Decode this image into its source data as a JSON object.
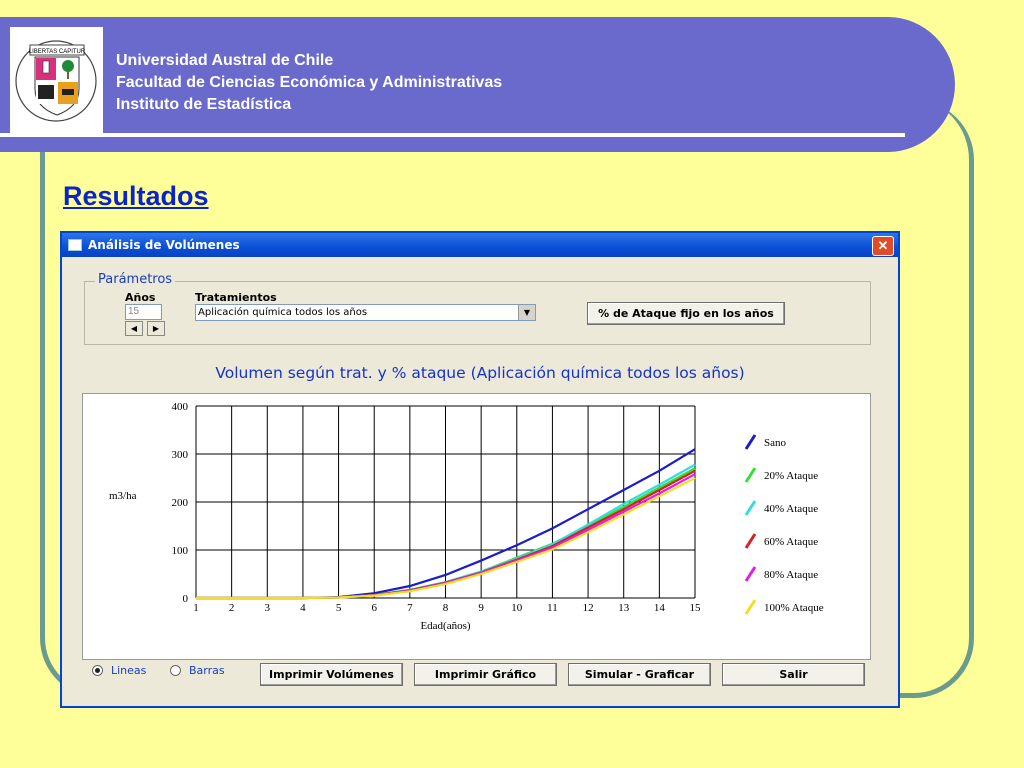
{
  "header": {
    "lines": [
      "Universidad Austral de Chile",
      "Facultad de Ciencias Económica y Administrativas",
      "Instituto de Estadística"
    ],
    "logo_motto": "LIBERTAS CAPITUR",
    "logo_ring": "UNIVERSIDAD AUSTRAL DE CHILE"
  },
  "slide_title": "Resultados",
  "window": {
    "title": "Análisis de Volúmenes",
    "close_label": "✕",
    "parameters": {
      "group_label": "Parámetros",
      "years_label": "Años",
      "years_value": "15",
      "treatments_label": "Tratamientos",
      "treatment_selected": "Aplicación química todos los años",
      "fixed_attack_button": "% de Ataque fijo en los años"
    },
    "chart_title": "Volumen según trat. y % ataque (Aplicación química todos los años)",
    "view": {
      "lines_label": "Lineas",
      "bars_label": "Barras",
      "selected": "Lineas"
    },
    "buttons": {
      "print_volumes": "Imprimir Volúmenes",
      "print_chart": "Imprimir Gráfico",
      "simulate": "Simular - Graficar",
      "exit": "Salir"
    }
  },
  "chart_data": {
    "type": "line",
    "xlabel": "Edad(años)",
    "ylabel": "m3/ha",
    "xlim": [
      1,
      15
    ],
    "ylim": [
      0,
      400
    ],
    "x": [
      1,
      2,
      3,
      4,
      5,
      6,
      7,
      8,
      9,
      10,
      11,
      12,
      13,
      14,
      15
    ],
    "yticks": [
      0,
      100,
      200,
      300,
      400
    ],
    "grid": true,
    "legend_position": "right",
    "series": [
      {
        "name": "Sano",
        "color": "#1c1cc8",
        "values": [
          0,
          0,
          0,
          0,
          2,
          10,
          25,
          48,
          78,
          110,
          145,
          185,
          225,
          265,
          310
        ]
      },
      {
        "name": "20% Ataque",
        "color": "#33e033",
        "values": [
          0,
          0,
          0,
          0,
          1,
          6,
          17,
          33,
          55,
          84,
          113,
          150,
          190,
          230,
          270
        ]
      },
      {
        "name": "40% Ataque",
        "color": "#33dddd",
        "values": [
          0,
          0,
          0,
          0,
          1,
          6,
          17,
          33,
          55,
          82,
          112,
          153,
          196,
          236,
          278
        ]
      },
      {
        "name": "60% Ataque",
        "color": "#d82020",
        "values": [
          0,
          0,
          0,
          0,
          1,
          6,
          16,
          32,
          53,
          80,
          108,
          147,
          185,
          225,
          265
        ]
      },
      {
        "name": "80% Ataque",
        "color": "#e020e0",
        "values": [
          0,
          0,
          0,
          0,
          1,
          5,
          15,
          31,
          52,
          78,
          105,
          142,
          180,
          218,
          258
        ]
      },
      {
        "name": "100% Ataque",
        "color": "#f0e020",
        "values": [
          0,
          0,
          0,
          0,
          1,
          5,
          14,
          29,
          50,
          75,
          101,
          137,
          174,
          212,
          250
        ]
      }
    ]
  }
}
